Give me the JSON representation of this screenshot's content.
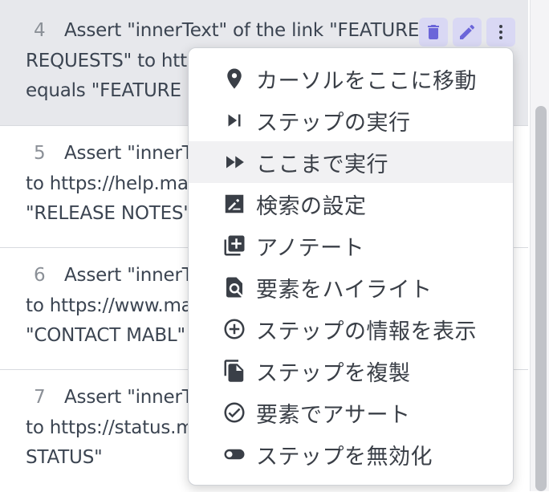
{
  "steps": [
    {
      "number": "4",
      "lines": [
        "Assert \"innerText\" of the link \"FEATURE",
        "REQUESTS\" to http",
        "equals \"FEATURE R"
      ]
    },
    {
      "number": "5",
      "lines": [
        "Assert \"innerT",
        "to https://help.ma",
        "\"RELEASE NOTES\""
      ]
    },
    {
      "number": "6",
      "lines": [
        "Assert \"innerT",
        "to https://www.ma",
        "\"CONTACT MABL\""
      ]
    },
    {
      "number": "7",
      "lines": [
        "Assert \"innerT",
        "to https://status.m",
        "STATUS\""
      ]
    }
  ],
  "step_actions": [
    {
      "icon": "trash-icon",
      "color": "#6b66d9"
    },
    {
      "icon": "pencil-icon",
      "color": "#6b66d9"
    },
    {
      "icon": "more-vertical-icon",
      "color": "#3a3f47"
    }
  ],
  "context_menu": {
    "items": [
      {
        "icon": "location-pin-icon",
        "label": "カーソルをここに移動"
      },
      {
        "icon": "step-forward-icon",
        "label": "ステップの実行"
      },
      {
        "icon": "fast-forward-icon",
        "label": "ここまで実行",
        "highlighted": true
      },
      {
        "icon": "edit-find-icon",
        "label": "検索の設定"
      },
      {
        "icon": "add-annotation-icon",
        "label": "アノテート"
      },
      {
        "icon": "find-in-page-icon",
        "label": "要素をハイライト"
      },
      {
        "icon": "add-circle-icon",
        "label": "ステップの情報を表示"
      },
      {
        "icon": "duplicate-icon",
        "label": "ステップを複製"
      },
      {
        "icon": "check-circle-icon",
        "label": "要素でアサート"
      },
      {
        "icon": "toggle-off-icon",
        "label": "ステップを無効化"
      }
    ]
  },
  "colors": {
    "accent": "#6b66d9",
    "accent_bg": "#d9d8f4",
    "selected_row": "#e7e8ec",
    "menu_highlight": "#f1f1f3"
  }
}
